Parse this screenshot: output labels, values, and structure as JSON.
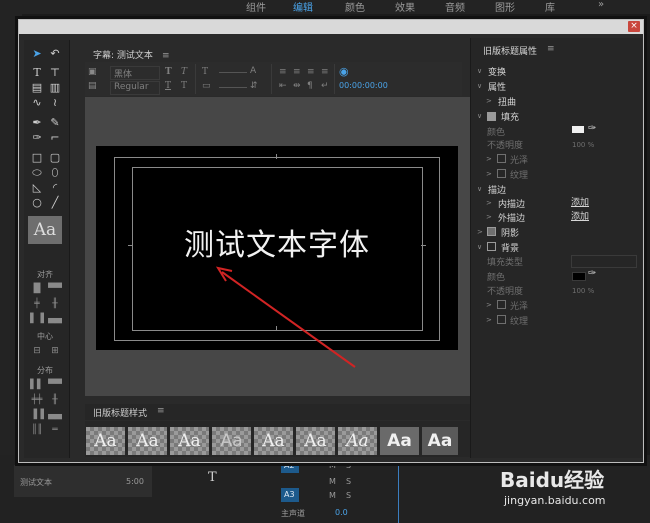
{
  "workspace_tabs": [
    "组件",
    "编辑",
    "颜色",
    "效果",
    "音频",
    "图形",
    "库"
  ],
  "workspace_overflow": "»",
  "dialog": {
    "close_label": "×",
    "title_panel": "字幕: 测试文本",
    "menu_icon": "≡"
  },
  "tools": {
    "align_label": "对齐",
    "center_label": "中心",
    "distribute_label": "分布",
    "style_preview": "Aa"
  },
  "toolbar": {
    "font_family": "黑体",
    "font_style": "Regular",
    "timecode": "00:00:00:00"
  },
  "canvas": {
    "text": "测试文本字体"
  },
  "styles_panel": {
    "title": "旧版标题样式",
    "swatches": [
      "Aa",
      "Aa",
      "Aa",
      "Aa",
      "Aa",
      "Aa",
      "Aa",
      "Aa",
      "Aa"
    ]
  },
  "properties": {
    "title": "旧版标题属性",
    "transform": "变换",
    "attributes": "属性",
    "distort": "扭曲",
    "fill": "填充",
    "color": "颜色",
    "opacity": "不透明度",
    "opacity_value": "100 %",
    "sheen": "光泽",
    "texture": "纹理",
    "strokes": "描边",
    "inner_stroke": "内描边",
    "outer_stroke": "外描边",
    "add": "添加",
    "shadow": "阴影",
    "background": "背景",
    "fill_type": "填充类型",
    "bg_color": "颜色",
    "bg_opacity": "不透明度",
    "bg_opacity_value": "100 %",
    "bg_sheen": "光泽",
    "bg_texture": "纹理",
    "fill_color": "#f0f0f0",
    "bg_color_value": "#000000"
  },
  "background_app": {
    "clip_name": "测试文本",
    "clip_duration": "5:00",
    "track_a2": "A2",
    "track_a3": "A3",
    "master": "主声道",
    "master_value": "0.0",
    "m_label": "M",
    "s_label": "S"
  },
  "watermark": {
    "brand": "Baidu经验",
    "url": "jingyan.baidu.com"
  }
}
